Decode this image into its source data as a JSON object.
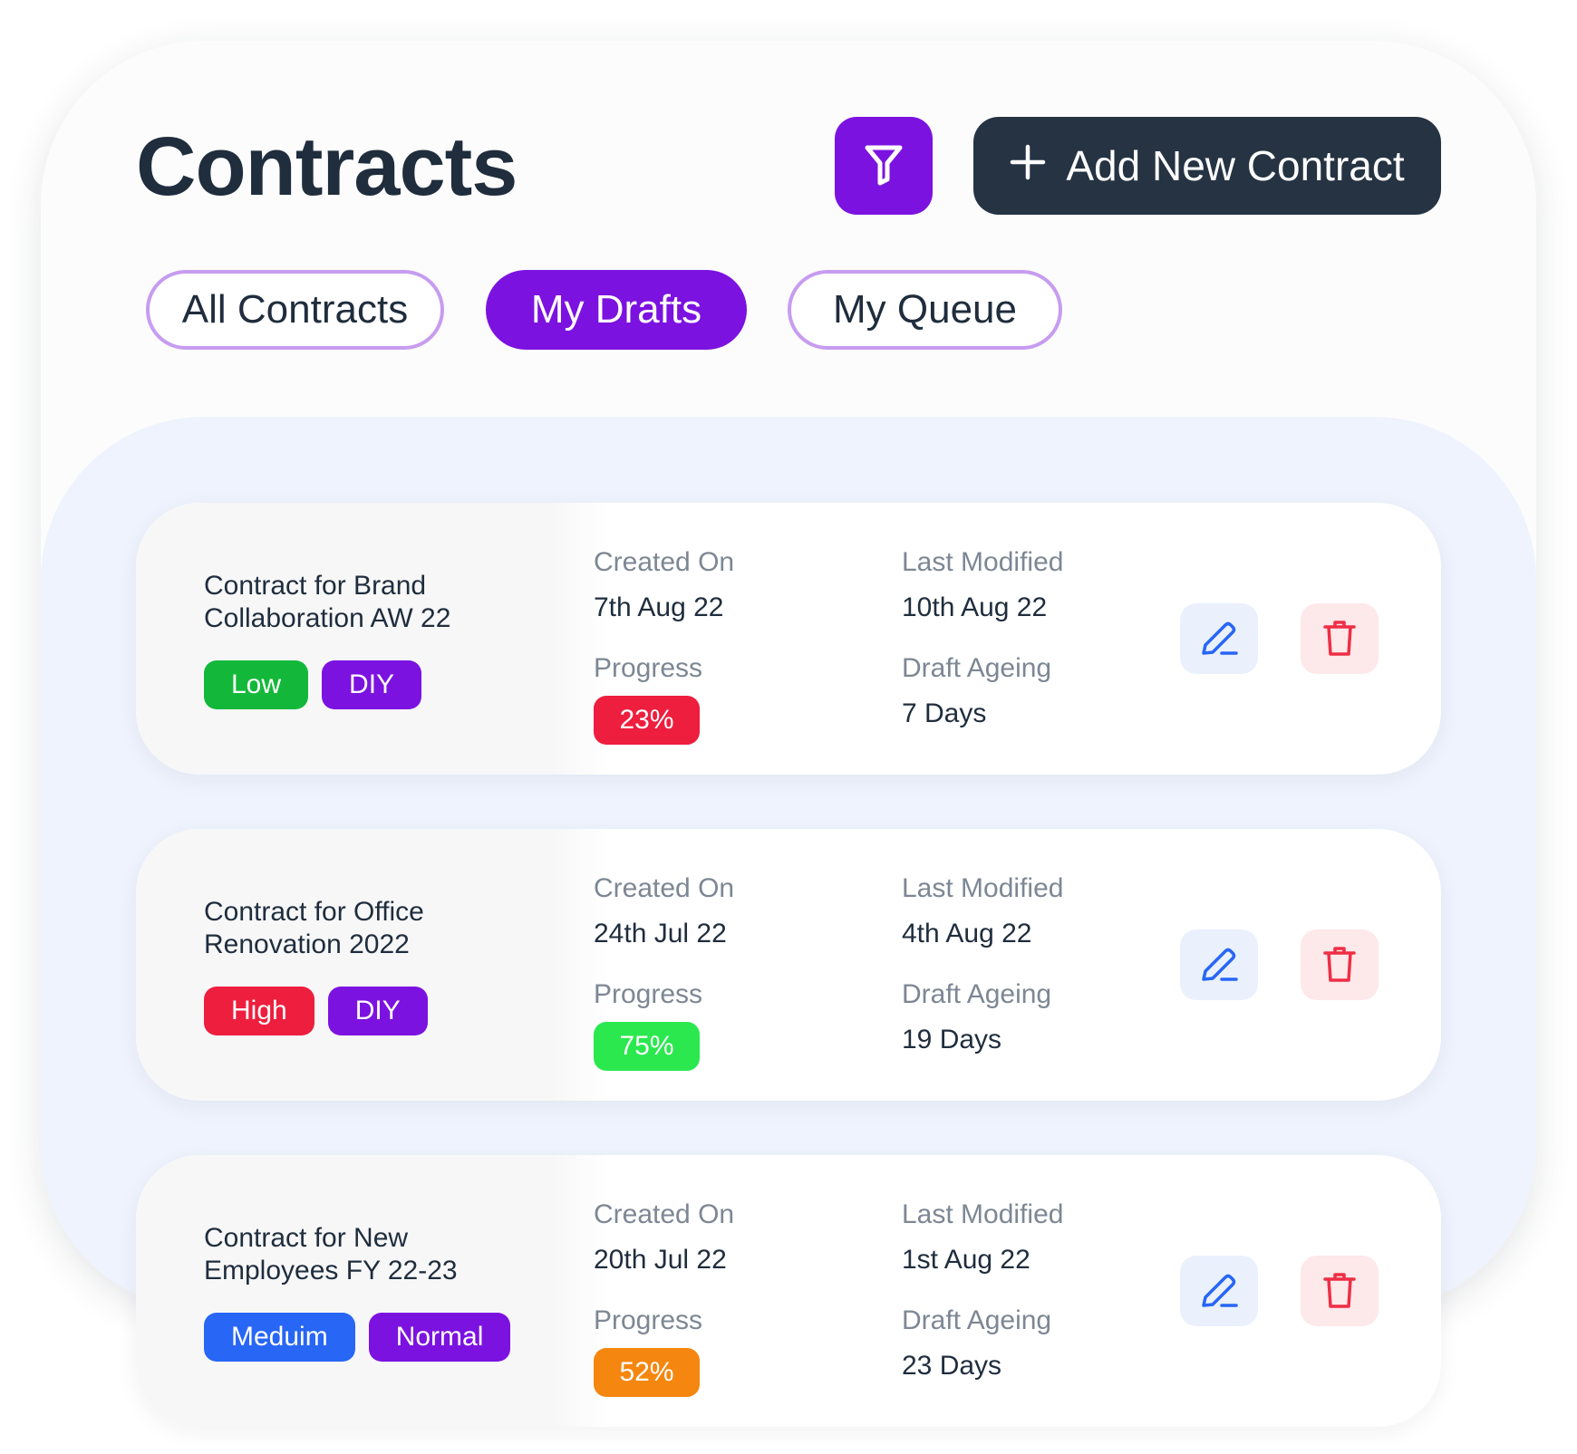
{
  "header": {
    "title": "Contracts",
    "add_button_label": "Add New Contract",
    "filter_icon": "filter-icon",
    "plus_icon": "plus-icon"
  },
  "tabs": [
    {
      "label": "All Contracts",
      "active": false
    },
    {
      "label": "My Drafts",
      "active": true
    },
    {
      "label": "My Queue",
      "active": false
    }
  ],
  "labels": {
    "created_on": "Created On",
    "last_modified": "Last Modified",
    "progress": "Progress",
    "draft_ageing": "Draft Ageing"
  },
  "contracts": [
    {
      "title": "Contract for Brand Collaboration AW 22",
      "priority": "Low",
      "priority_color": "#13b83a",
      "type": "DIY",
      "type_color": "#7c12e0",
      "created_on": "7th Aug 22",
      "last_modified": "10th Aug 22",
      "progress": "23%",
      "progress_color": "#ee1e3e",
      "draft_ageing": "7 Days"
    },
    {
      "title": "Contract for Office Renovation 2022",
      "priority": "High",
      "priority_color": "#ee1e3e",
      "type": "DIY",
      "type_color": "#7c12e0",
      "created_on": "24th Jul 22",
      "last_modified": "4th Aug 22",
      "progress": "75%",
      "progress_color": "#2ae84e",
      "draft_ageing": "19 Days"
    },
    {
      "title": "Contract for New Employees FY 22-23",
      "priority": "Meduim",
      "priority_color": "#2866f5",
      "type": "Normal",
      "type_color": "#7c12e0",
      "created_on": "20th Jul 22",
      "last_modified": "1st Aug 22",
      "progress": "52%",
      "progress_color": "#f5860f",
      "draft_ageing": "23 Days"
    }
  ],
  "icons": {
    "edit": "pencil-icon",
    "delete": "trash-icon"
  },
  "colors": {
    "accent": "#7c12e0",
    "dark": "#253343",
    "edit_icon": "#2866f5",
    "delete_icon": "#ee2e45"
  }
}
